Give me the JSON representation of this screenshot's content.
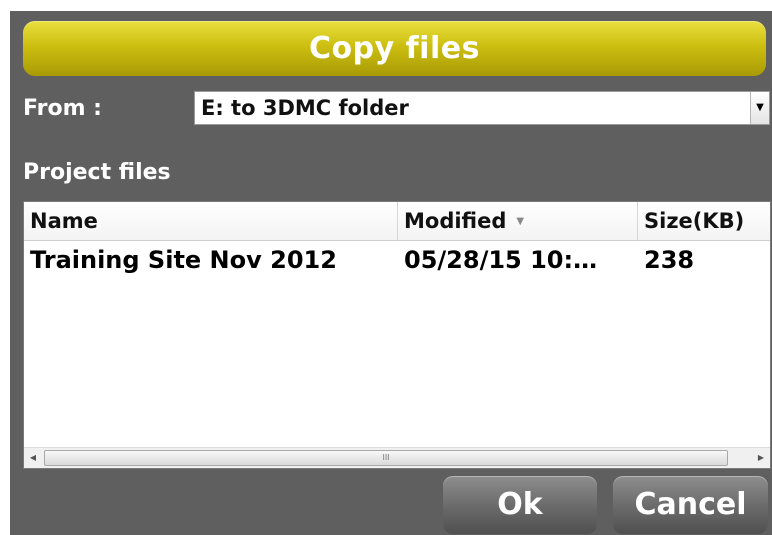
{
  "dialog": {
    "title": "Copy files",
    "from_label": "From :",
    "from_value": "E: to 3DMC folder",
    "section_label": "Project files"
  },
  "file_list": {
    "columns": [
      {
        "label": "Name"
      },
      {
        "label": "Modified",
        "sort_icon": "sort-down-icon"
      },
      {
        "label": "Size(KB)"
      }
    ],
    "rows": [
      {
        "name": "Training Site Nov 2012",
        "modified": "05/28/15 10:…",
        "size": "238"
      }
    ],
    "scrollbar_grip": "III"
  },
  "buttons": {
    "ok": "Ok",
    "cancel": "Cancel"
  },
  "colors": {
    "title_bar": "#cdbf10",
    "dialog_bg": "#5f5f5f",
    "button": "#6c6c6c"
  }
}
